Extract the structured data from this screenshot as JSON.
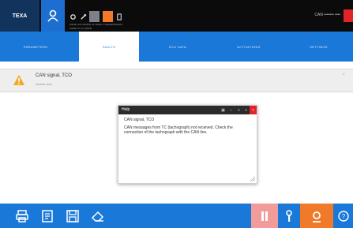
{
  "topbar": {
    "logo_text": "TEXA",
    "vehicle_line1": "••••••• ••• •••••••• •• •••••• • ••••••••••••••••",
    "vehicle_line2": "••••••• •• •• •••••••",
    "connection_label": "CAN ••••••• ••••"
  },
  "nav": {
    "tabs": [
      {
        "label": "PARAMETERS",
        "active": false
      },
      {
        "label": "FAULTS",
        "active": true
      },
      {
        "label": "ECU DATA",
        "active": false
      },
      {
        "label": "ACTIVATIONS",
        "active": false
      },
      {
        "label": "SETTINGS",
        "active": false
      }
    ]
  },
  "fault": {
    "title": "CAN signal, TCO",
    "subtitle": "••••••••• •••••"
  },
  "dialog": {
    "title": "Help",
    "heading": "CAN signal, TCO",
    "body": "CAN messages from TC (tachograph) not received. Check the connection of the tachograph with the CAN line."
  },
  "colors": {
    "topbar": "#0b0b0b",
    "nav_blue": "#1a78d8",
    "accent_red": "#e3232a",
    "warning": "#f5a623",
    "pause_pink": "#f29b9b",
    "gear_orange": "#f07a2a"
  },
  "icons": {
    "topbar": [
      "user-icon",
      "gear-icon",
      "wrench-icon",
      "document-icon",
      "vehicle-icon",
      "battery-icon"
    ],
    "fault": "warning-icon",
    "bottombar": [
      "print-icon",
      "report-icon",
      "save-icon",
      "erase-icon",
      "pause-icon",
      "wrench-icon",
      "settings-gear-icon",
      "help-icon"
    ]
  }
}
